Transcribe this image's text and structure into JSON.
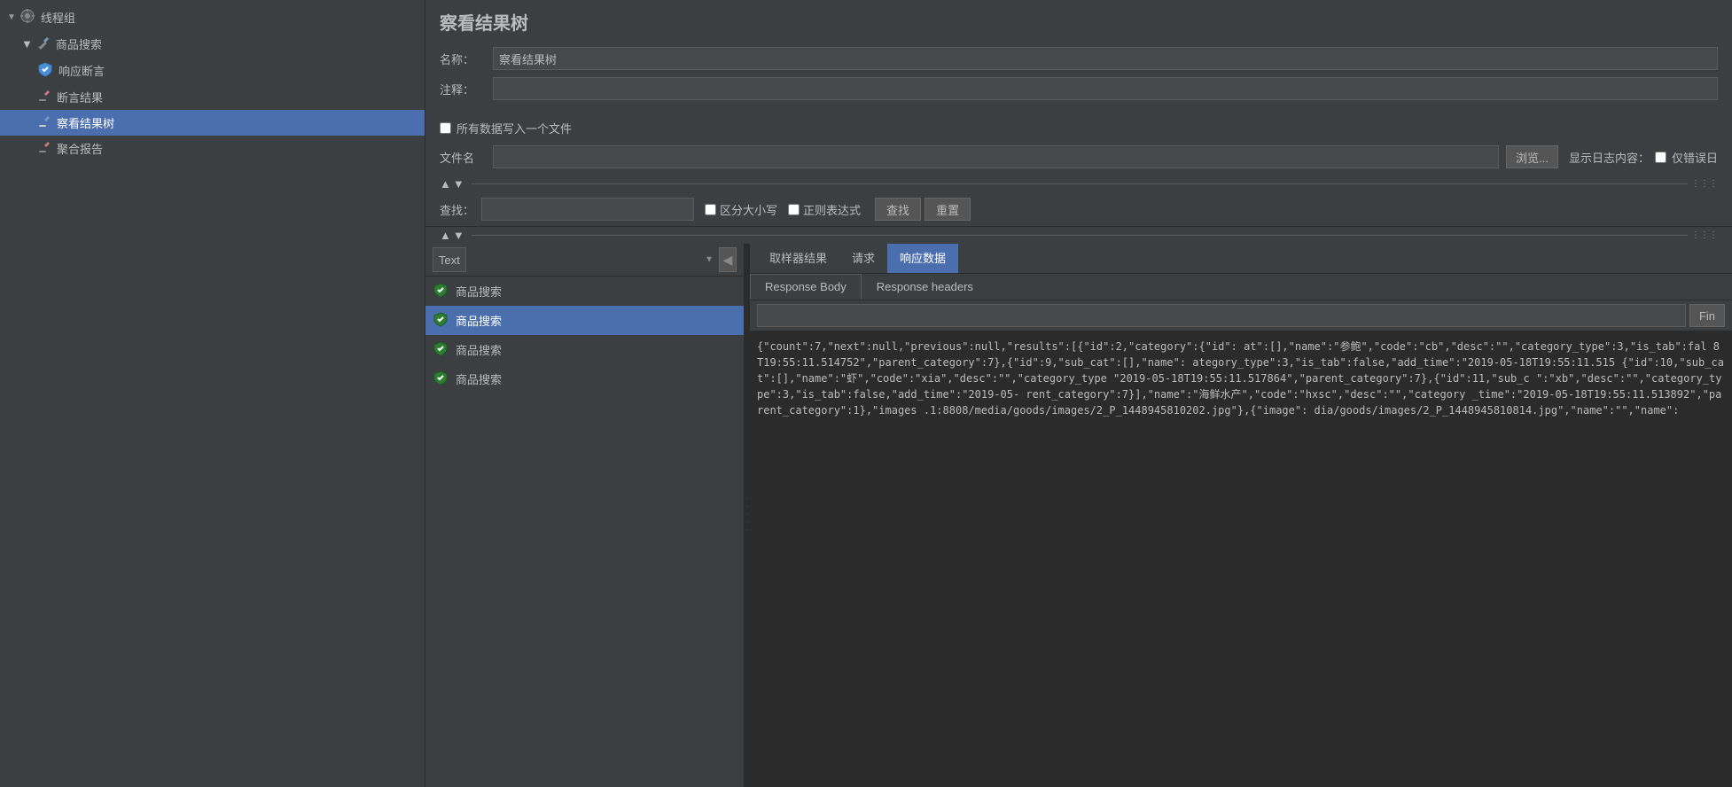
{
  "sidebar": {
    "group_label": "线程组",
    "items": [
      {
        "id": "goods-search-main",
        "label": "商品搜索",
        "type": "group",
        "indent": 1
      },
      {
        "id": "response-assert",
        "label": "响应断言",
        "type": "item",
        "indent": 2
      },
      {
        "id": "assert-result",
        "label": "断言结果",
        "type": "item",
        "indent": 2
      },
      {
        "id": "view-result-tree",
        "label": "察看结果树",
        "type": "item",
        "indent": 2,
        "selected": true
      },
      {
        "id": "aggregate-report",
        "label": "聚合报告",
        "type": "item",
        "indent": 2
      }
    ]
  },
  "main": {
    "title": "察看结果树",
    "name_label": "名称：",
    "name_value": "察看结果树",
    "comment_label": "注释：",
    "comment_value": "",
    "checkbox_label": "所有数据写入一个文件",
    "filename_label": "文件名",
    "filename_value": "",
    "browse_label": "浏览...",
    "log_content_label": "显示日志内容：",
    "error_only_label": "仅错误日",
    "search_label": "查找：",
    "search_placeholder": "",
    "case_sensitive_label": "区分大小写",
    "regex_label": "正则表达式",
    "find_btn_label": "查找",
    "reset_btn_label": "重置"
  },
  "tree": {
    "select_value": "Text",
    "items": [
      {
        "id": "item1",
        "label": "商品搜索",
        "selected": false
      },
      {
        "id": "item2",
        "label": "商品搜索",
        "selected": true
      },
      {
        "id": "item3",
        "label": "商品搜索",
        "selected": false
      },
      {
        "id": "item4",
        "label": "商品搜索",
        "selected": false
      }
    ]
  },
  "right_panel": {
    "tabs": [
      {
        "id": "sampler-result",
        "label": "取样器结果"
      },
      {
        "id": "request",
        "label": "请求"
      },
      {
        "id": "response-data",
        "label": "响应数据",
        "active": true
      }
    ],
    "sub_tabs": [
      {
        "id": "response-body",
        "label": "Response Body",
        "active": true
      },
      {
        "id": "response-headers",
        "label": "Response headers"
      }
    ],
    "find_btn_label": "Fin",
    "response_text": "{\"count\":7,\"next\":null,\"previous\":null,\"results\":[{\"id\":2,\"category\":{\"id\":\nat\":[],\"name\":\"参鲍\",\"code\":\"cb\",\"desc\":\"\",\"category_type\":3,\"is_tab\":fal\n8T19:55:11.514752\",\"parent_category\":7},{\"id\":9,\"sub_cat\":[],\"name\":\nategory_type\":3,\"is_tab\":false,\"add_time\":\"2019-05-18T19:55:11.515\n{\"id\":10,\"sub_cat\":[],\"name\":\"虾\",\"code\":\"xia\",\"desc\":\"\",\"category_type\n\"2019-05-18T19:55:11.517864\",\"parent_category\":7},{\"id\":11,\"sub_c\n\":\"xb\",\"desc\":\"\",\"category_type\":3,\"is_tab\":false,\"add_time\":\"2019-05-\nrent_category\":7}],\"name\":\"海鲜水产\",\"code\":\"hxsc\",\"desc\":\"\",\"category\n_time\":\"2019-05-18T19:55:11.513892\",\"parent_category\":1},\"images\n.1:8808/media/goods/images/2_P_1448945810202.jpg\"},{\"image\":\ndia/goods/images/2_P_1448945810814.jpg\",\"name\":\"\",\"name\":"
  },
  "colors": {
    "sidebar_bg": "#3c3f41",
    "selected_bg": "#4b6eaf",
    "input_bg": "#45494a",
    "border": "#5a5a5a",
    "active_tab_bg": "#4b6eaf",
    "response_bg": "#2b2b2b"
  }
}
